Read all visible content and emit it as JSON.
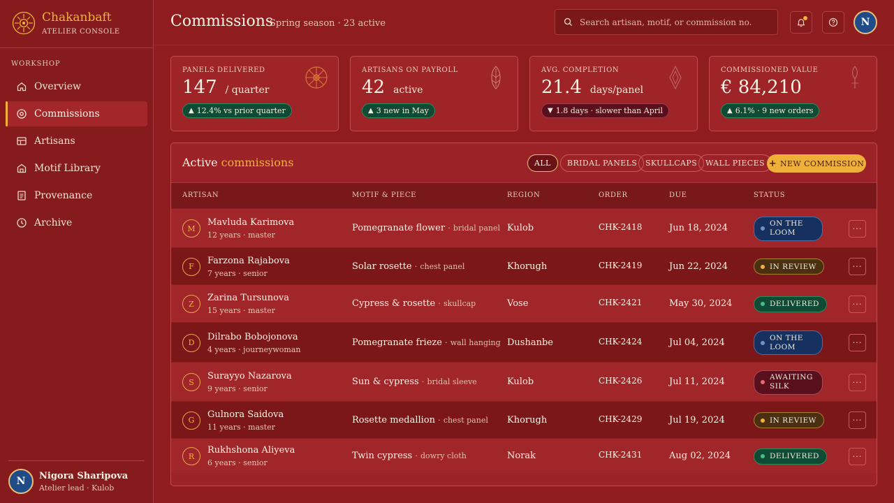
{
  "brand": {
    "name": "Chakanbaft",
    "subtitle": "ATELIER CONSOLE"
  },
  "sidebar": {
    "section": "WORKSHOP",
    "items": [
      {
        "label": "Overview",
        "icon": "home-icon",
        "active": false
      },
      {
        "label": "Commissions",
        "icon": "target-icon",
        "active": true
      },
      {
        "label": "Artisans",
        "icon": "grid-icon",
        "active": false
      },
      {
        "label": "Motif Library",
        "icon": "library-icon",
        "active": false
      },
      {
        "label": "Provenance",
        "icon": "document-icon",
        "active": false
      },
      {
        "label": "Archive",
        "icon": "clock-icon",
        "active": false
      }
    ]
  },
  "profile": {
    "initial": "N",
    "name": "Nigora Sharipova",
    "role": "Atelier lead · Kulob"
  },
  "header": {
    "title": "Commissions",
    "subtitle": "Spring season · 23 active",
    "search_placeholder": "Search artisan, motif, or commission no.",
    "avatar_initial": "N"
  },
  "kpis": [
    {
      "label": "PANELS DELIVERED",
      "value": "147",
      "unit": "/ quarter",
      "delta": "12.4% vs prior quarter",
      "trend": "up",
      "icon": "rosette-ornament-icon"
    },
    {
      "label": "ARTISANS ON PAYROLL",
      "value": "42",
      "unit": "active",
      "delta": "3 new in May",
      "trend": "up",
      "icon": "leaf-ornament-icon"
    },
    {
      "label": "AVG. COMPLETION",
      "value": "21.4",
      "unit": "days/panel",
      "delta": "1.8 days · slower than April",
      "trend": "down",
      "icon": "diamond-ornament-icon"
    },
    {
      "label": "COMMISSIONED VALUE",
      "value": "€ 84,210",
      "unit": "",
      "delta": "6.1% · 9 new orders",
      "trend": "up",
      "icon": "cypress-ornament-icon"
    }
  ],
  "table": {
    "title_prefix": "Active",
    "title_accent": "commissions",
    "filters": [
      "ALL",
      "BRIDAL PANELS",
      "SKULLCAPS",
      "WALL PIECES"
    ],
    "active_filter": "ALL",
    "new_button": "NEW COMMISSION",
    "columns": [
      "ARTISAN",
      "MOTIF & PIECE",
      "REGION",
      "ORDER",
      "DUE",
      "STATUS"
    ],
    "rows": [
      {
        "initial": "M",
        "name": "Mavluda Karimova",
        "meta": "12 years · master",
        "motif": "Pomegranate flower",
        "piece": "bridal panel",
        "region": "Kulob",
        "order": "CHK-2418",
        "due": "Jun 18, 2024",
        "status": "ON THE LOOM",
        "status_kind": "loom"
      },
      {
        "initial": "F",
        "name": "Farzona Rajabova",
        "meta": "7 years · senior",
        "motif": "Solar rosette",
        "piece": "chest panel",
        "region": "Khorugh",
        "order": "CHK-2419",
        "due": "Jun 22, 2024",
        "status": "IN REVIEW",
        "status_kind": "review"
      },
      {
        "initial": "Z",
        "name": "Zarina Tursunova",
        "meta": "15 years · master",
        "motif": "Cypress & rosette",
        "piece": "skullcap",
        "region": "Vose",
        "order": "CHK-2421",
        "due": "May 30, 2024",
        "status": "DELIVERED",
        "status_kind": "delivered"
      },
      {
        "initial": "D",
        "name": "Dilrabo Bobojonova",
        "meta": "4 years · journeywoman",
        "motif": "Pomegranate frieze",
        "piece": "wall hanging",
        "region": "Dushanbe",
        "order": "CHK-2424",
        "due": "Jul 04, 2024",
        "status": "ON THE LOOM",
        "status_kind": "loom"
      },
      {
        "initial": "S",
        "name": "Surayyo Nazarova",
        "meta": "9 years · senior",
        "motif": "Sun & cypress",
        "piece": "bridal sleeve",
        "region": "Kulob",
        "order": "CHK-2426",
        "due": "Jul 11, 2024",
        "status": "AWAITING SILK",
        "status_kind": "silk"
      },
      {
        "initial": "G",
        "name": "Gulnora Saidova",
        "meta": "11 years · master",
        "motif": "Rosette medallion",
        "piece": "chest panel",
        "region": "Khorugh",
        "order": "CHK-2429",
        "due": "Jul 19, 2024",
        "status": "IN REVIEW",
        "status_kind": "review"
      },
      {
        "initial": "R",
        "name": "Rukhshona Aliyeva",
        "meta": "6 years · senior",
        "motif": "Twin cypress",
        "piece": "dowry cloth",
        "region": "Norak",
        "order": "CHK-2431",
        "due": "Aug 02, 2024",
        "status": "DELIVERED",
        "status_kind": "delivered"
      }
    ]
  },
  "colors": {
    "background": "#8f1d1f",
    "accent": "#f3b23a",
    "sidebar": "#851b1d",
    "positive": "#0f4a34",
    "negative": "#5a0f1c"
  }
}
